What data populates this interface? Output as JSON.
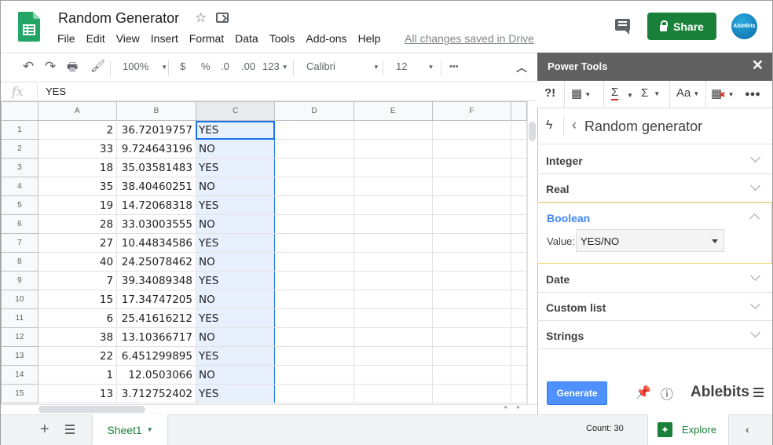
{
  "app": {
    "title": "Random Generator",
    "menu": [
      "File",
      "Edit",
      "View",
      "Insert",
      "Format",
      "Data",
      "Tools",
      "Add-ons",
      "Help"
    ],
    "saved_status": "All changes saved in Drive",
    "share_label": "Share",
    "avatar_text": "AbleBits"
  },
  "toolbar": {
    "zoom": "100%",
    "currency": "$",
    "percent": "%",
    "dec_less": ".0",
    "dec_more": ".00",
    "format": "123",
    "font": "Calibri",
    "font_size": "12",
    "more": "•••"
  },
  "formula_bar": {
    "icon": "fx",
    "value": "YES"
  },
  "grid": {
    "columns": [
      "A",
      "B",
      "C",
      "D",
      "E",
      "F"
    ],
    "selected_column": "C",
    "rows": [
      {
        "n": "1",
        "a": "2",
        "b": "36.72019757",
        "c": "YES"
      },
      {
        "n": "2",
        "a": "33",
        "b": "9.724643196",
        "c": "NO"
      },
      {
        "n": "3",
        "a": "18",
        "b": "35.03581483",
        "c": "YES"
      },
      {
        "n": "4",
        "a": "35",
        "b": "38.40460251",
        "c": "NO"
      },
      {
        "n": "5",
        "a": "19",
        "b": "14.72068318",
        "c": "YES"
      },
      {
        "n": "6",
        "a": "28",
        "b": "33.03003555",
        "c": "NO"
      },
      {
        "n": "7",
        "a": "27",
        "b": "10.44834586",
        "c": "YES"
      },
      {
        "n": "8",
        "a": "40",
        "b": "24.25078462",
        "c": "NO"
      },
      {
        "n": "9",
        "a": "7",
        "b": "39.34089348",
        "c": "YES"
      },
      {
        "n": "10",
        "a": "15",
        "b": "17.34747205",
        "c": "NO"
      },
      {
        "n": "11",
        "a": "6",
        "b": "25.41616212",
        "c": "YES"
      },
      {
        "n": "12",
        "a": "38",
        "b": "13.10366717",
        "c": "NO"
      },
      {
        "n": "13",
        "a": "22",
        "b": "6.451299895",
        "c": "YES"
      },
      {
        "n": "14",
        "a": "1",
        "b": "12.0503066",
        "c": "NO"
      },
      {
        "n": "15",
        "a": "13",
        "b": "3.712752402",
        "c": "YES"
      }
    ]
  },
  "bottom": {
    "sheet_tab": "Sheet1",
    "count": "Count: 30",
    "explore": "Explore"
  },
  "panel": {
    "title": "Power Tools",
    "section_title": "Random generator",
    "sections": [
      {
        "label": "Integer",
        "expanded": false
      },
      {
        "label": "Real",
        "expanded": false
      },
      {
        "label": "Boolean",
        "expanded": true
      },
      {
        "label": "Date",
        "expanded": false
      },
      {
        "label": "Custom list",
        "expanded": false
      },
      {
        "label": "Strings",
        "expanded": false
      }
    ],
    "boolean_value_label": "Value:",
    "boolean_value": "YES/NO",
    "generate_label": "Generate",
    "brand": "Ablebits",
    "accent_color": "#4285f4",
    "share_color": "#188038"
  }
}
